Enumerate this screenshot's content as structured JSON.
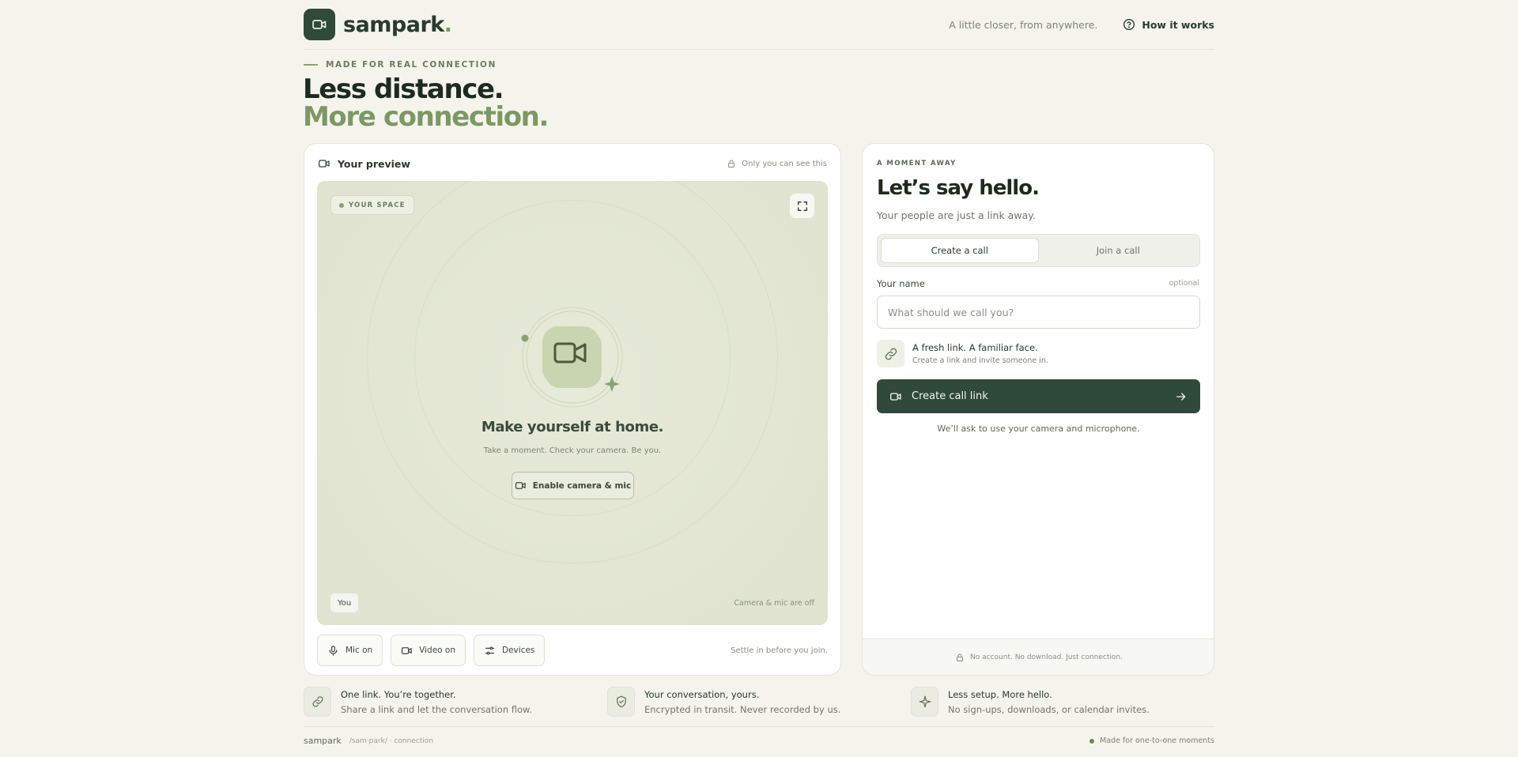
{
  "header": {
    "brand": "sampark",
    "brand_dot": ".",
    "tagline": "A little closer, from anywhere.",
    "how_link": "How it works"
  },
  "hero": {
    "eyebrow": "MADE FOR REAL CONNECTION",
    "line1": "Less distance.",
    "line2": "More connection."
  },
  "preview": {
    "title": "Your preview",
    "private_note": "Only you can see this",
    "space_badge": "YOUR SPACE",
    "heading": "Make yourself at home.",
    "subheading": "Take a moment. Check your camera. Be you.",
    "enable_button": "Enable camera & mic",
    "you_label": "You",
    "cam_status": "Camera & mic are off",
    "controls": {
      "mic": "Mic on",
      "video": "Video on",
      "devices": "Devices"
    },
    "settle_note": "Settle in before you join."
  },
  "call": {
    "eyebrow": "A MOMENT AWAY",
    "title": "Let’s say hello.",
    "subtitle": "Your people are just a link away.",
    "tabs": [
      {
        "label": "Create a call",
        "active": true
      },
      {
        "label": "Join a call",
        "active": false
      }
    ],
    "name_label": "Your name",
    "optional_label": "optional",
    "name_placeholder": "What should we call you?",
    "name_value": "",
    "fresh_title": "A fresh link. A familiar face.",
    "fresh_sub": "Create a link and invite someone in.",
    "create_button": "Create call link",
    "permission_note": "We’ll ask to use your camera and microphone.",
    "footer_note": "No account. No download. Just connection."
  },
  "features": [
    {
      "icon": "link-icon",
      "title": "One link. You’re together.",
      "sub": "Share a link and let the conversation flow."
    },
    {
      "icon": "shield-check-icon",
      "title": "Your conversation, yours.",
      "sub": "Encrypted in transit. Never recorded by us."
    },
    {
      "icon": "sparkle-icon",
      "title": "Less setup. More hello.",
      "sub": "No sign-ups, downloads, or calendar invites."
    }
  ],
  "footer": {
    "brand": "sampark",
    "path": "/sam·park/ · connection",
    "right_note": "Made for one-to-one moments"
  },
  "colors": {
    "background": "#f4f4ed",
    "brand_green": "#2f4a36",
    "accent_olive": "#7d9863",
    "primary_button": "#2f4a3a"
  }
}
